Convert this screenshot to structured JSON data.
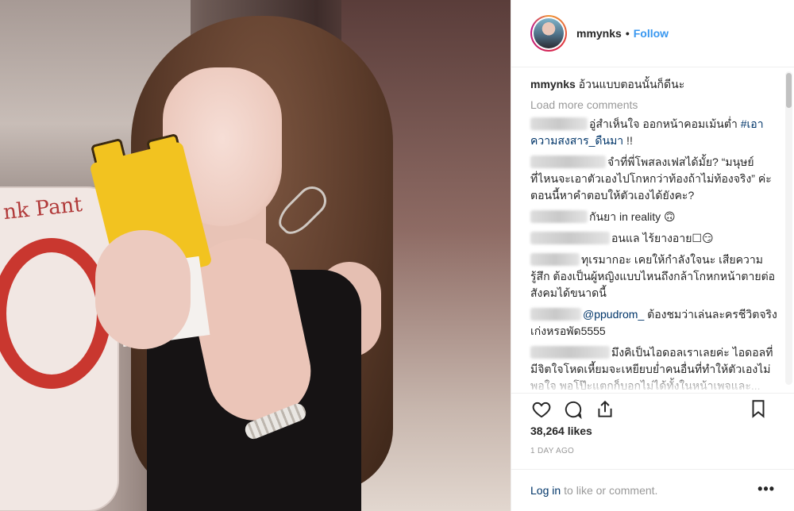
{
  "post": {
    "username": "mmynks",
    "follow_label": "Follow",
    "separator": "•",
    "caption_user": "mmynks",
    "caption_text": "อ้วนแบบตอนนั้นก็ดีนะ",
    "load_more": "Load more comments",
    "comments": [
      {
        "text": "อู่สำเห็นใจ ออกหน้าคอมเม้นต่ำ ",
        "tag": "#เอาความสงสาร_ดืนมา",
        "tail": " !!"
      },
      {
        "text": "จำที่พี่โพสลงเฟสได้มั้ย? “มนุษย์ที่ไหนจะเอาตัวเองไปโกหกว่าท้องถ้าไม่ท้องจริง” ค่ะ ตอนนี้หาคำตอบให้ตัวเองได้ยังคะ?"
      },
      {
        "text": "กันยา in reality 🙃"
      },
      {
        "text": "อนแล ไร้ยางอาย☐😏"
      },
      {
        "text": "ทุเรมากอะ เคยให้กำลังใจนะ เสียความรู้สึก ต้องเป็นผู้หญิงแบบไหนถึงกล้าโกหกหน้าตายต่อสังคมได้ขนาดนี้"
      },
      {
        "tag": "@ppudrom_",
        "tail": " ต้องชมว่าเล่นละครชีวิตจริงเก่งหรอพัด5555"
      },
      {
        "text": "มึงคิเป็นไอดอลเราเลยค่ะ ไอดอลที่มีจิตใจโหดเหี้ยมจะเหยียบย่ำคนอื่นที่ทำให้ตัวเองไม่พอใจ พอโป๊ะแตกก็บอกไม่ได้ทั้งในหน้าเพจและ..."
      }
    ],
    "likes": "38,264 likes",
    "time_ago": "1 DAY AGO",
    "login_link": "Log in",
    "login_text": "to like or comment.",
    "more_label": "•••"
  },
  "icons": [
    "heart-icon",
    "comment-icon",
    "share-icon",
    "bookmark-icon",
    "more-options-icon"
  ],
  "colors": {
    "link_blue": "#3897f0",
    "tag_blue": "#003569",
    "muted": "#999999",
    "text": "#262626"
  }
}
